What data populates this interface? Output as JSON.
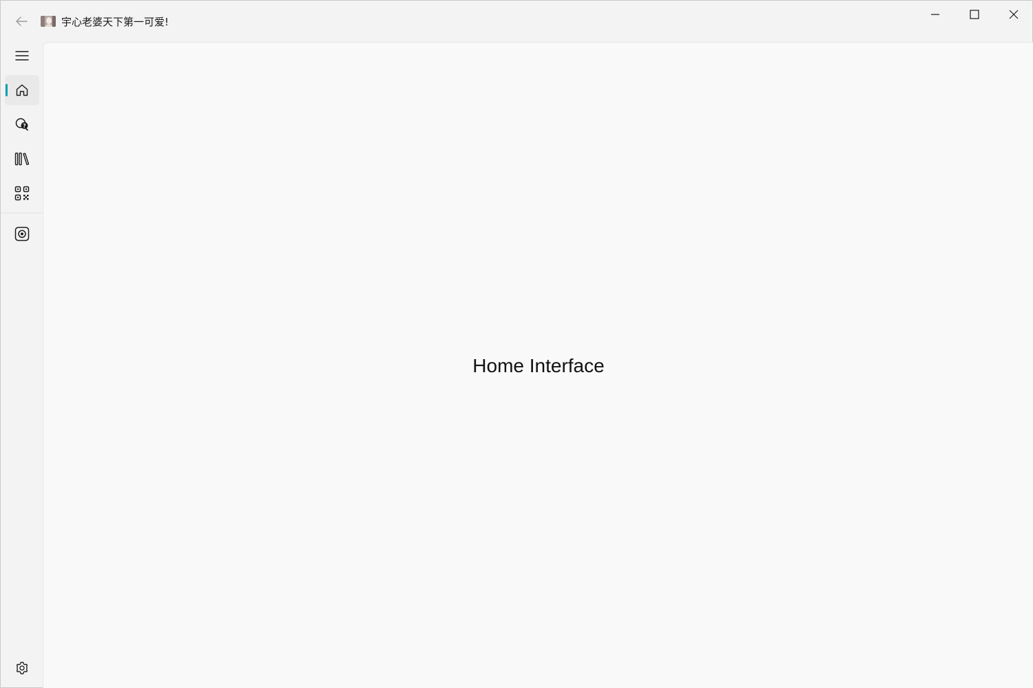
{
  "window": {
    "title": "宇心老婆天下第一可爱!"
  },
  "titlebar": {
    "back_icon": "arrow-left-icon",
    "app_icon": "avatar-image-icon",
    "controls": [
      "minimize-icon",
      "maximize-icon",
      "close-icon"
    ]
  },
  "nav": {
    "menu_icon": "hamburger-menu-icon",
    "items": [
      {
        "key": "home",
        "icon": "home-icon",
        "selected": true
      },
      {
        "key": "search-help",
        "icon": "search-question-icon",
        "selected": false
      },
      {
        "key": "library",
        "icon": "library-icon",
        "selected": false
      },
      {
        "key": "qr",
        "icon": "qr-code-icon",
        "selected": false
      },
      {
        "key": "camera",
        "icon": "camera-icon",
        "selected": false
      }
    ],
    "settings_icon": "gear-icon",
    "accent": "#009faa"
  },
  "content": {
    "label": "Home Interface"
  }
}
